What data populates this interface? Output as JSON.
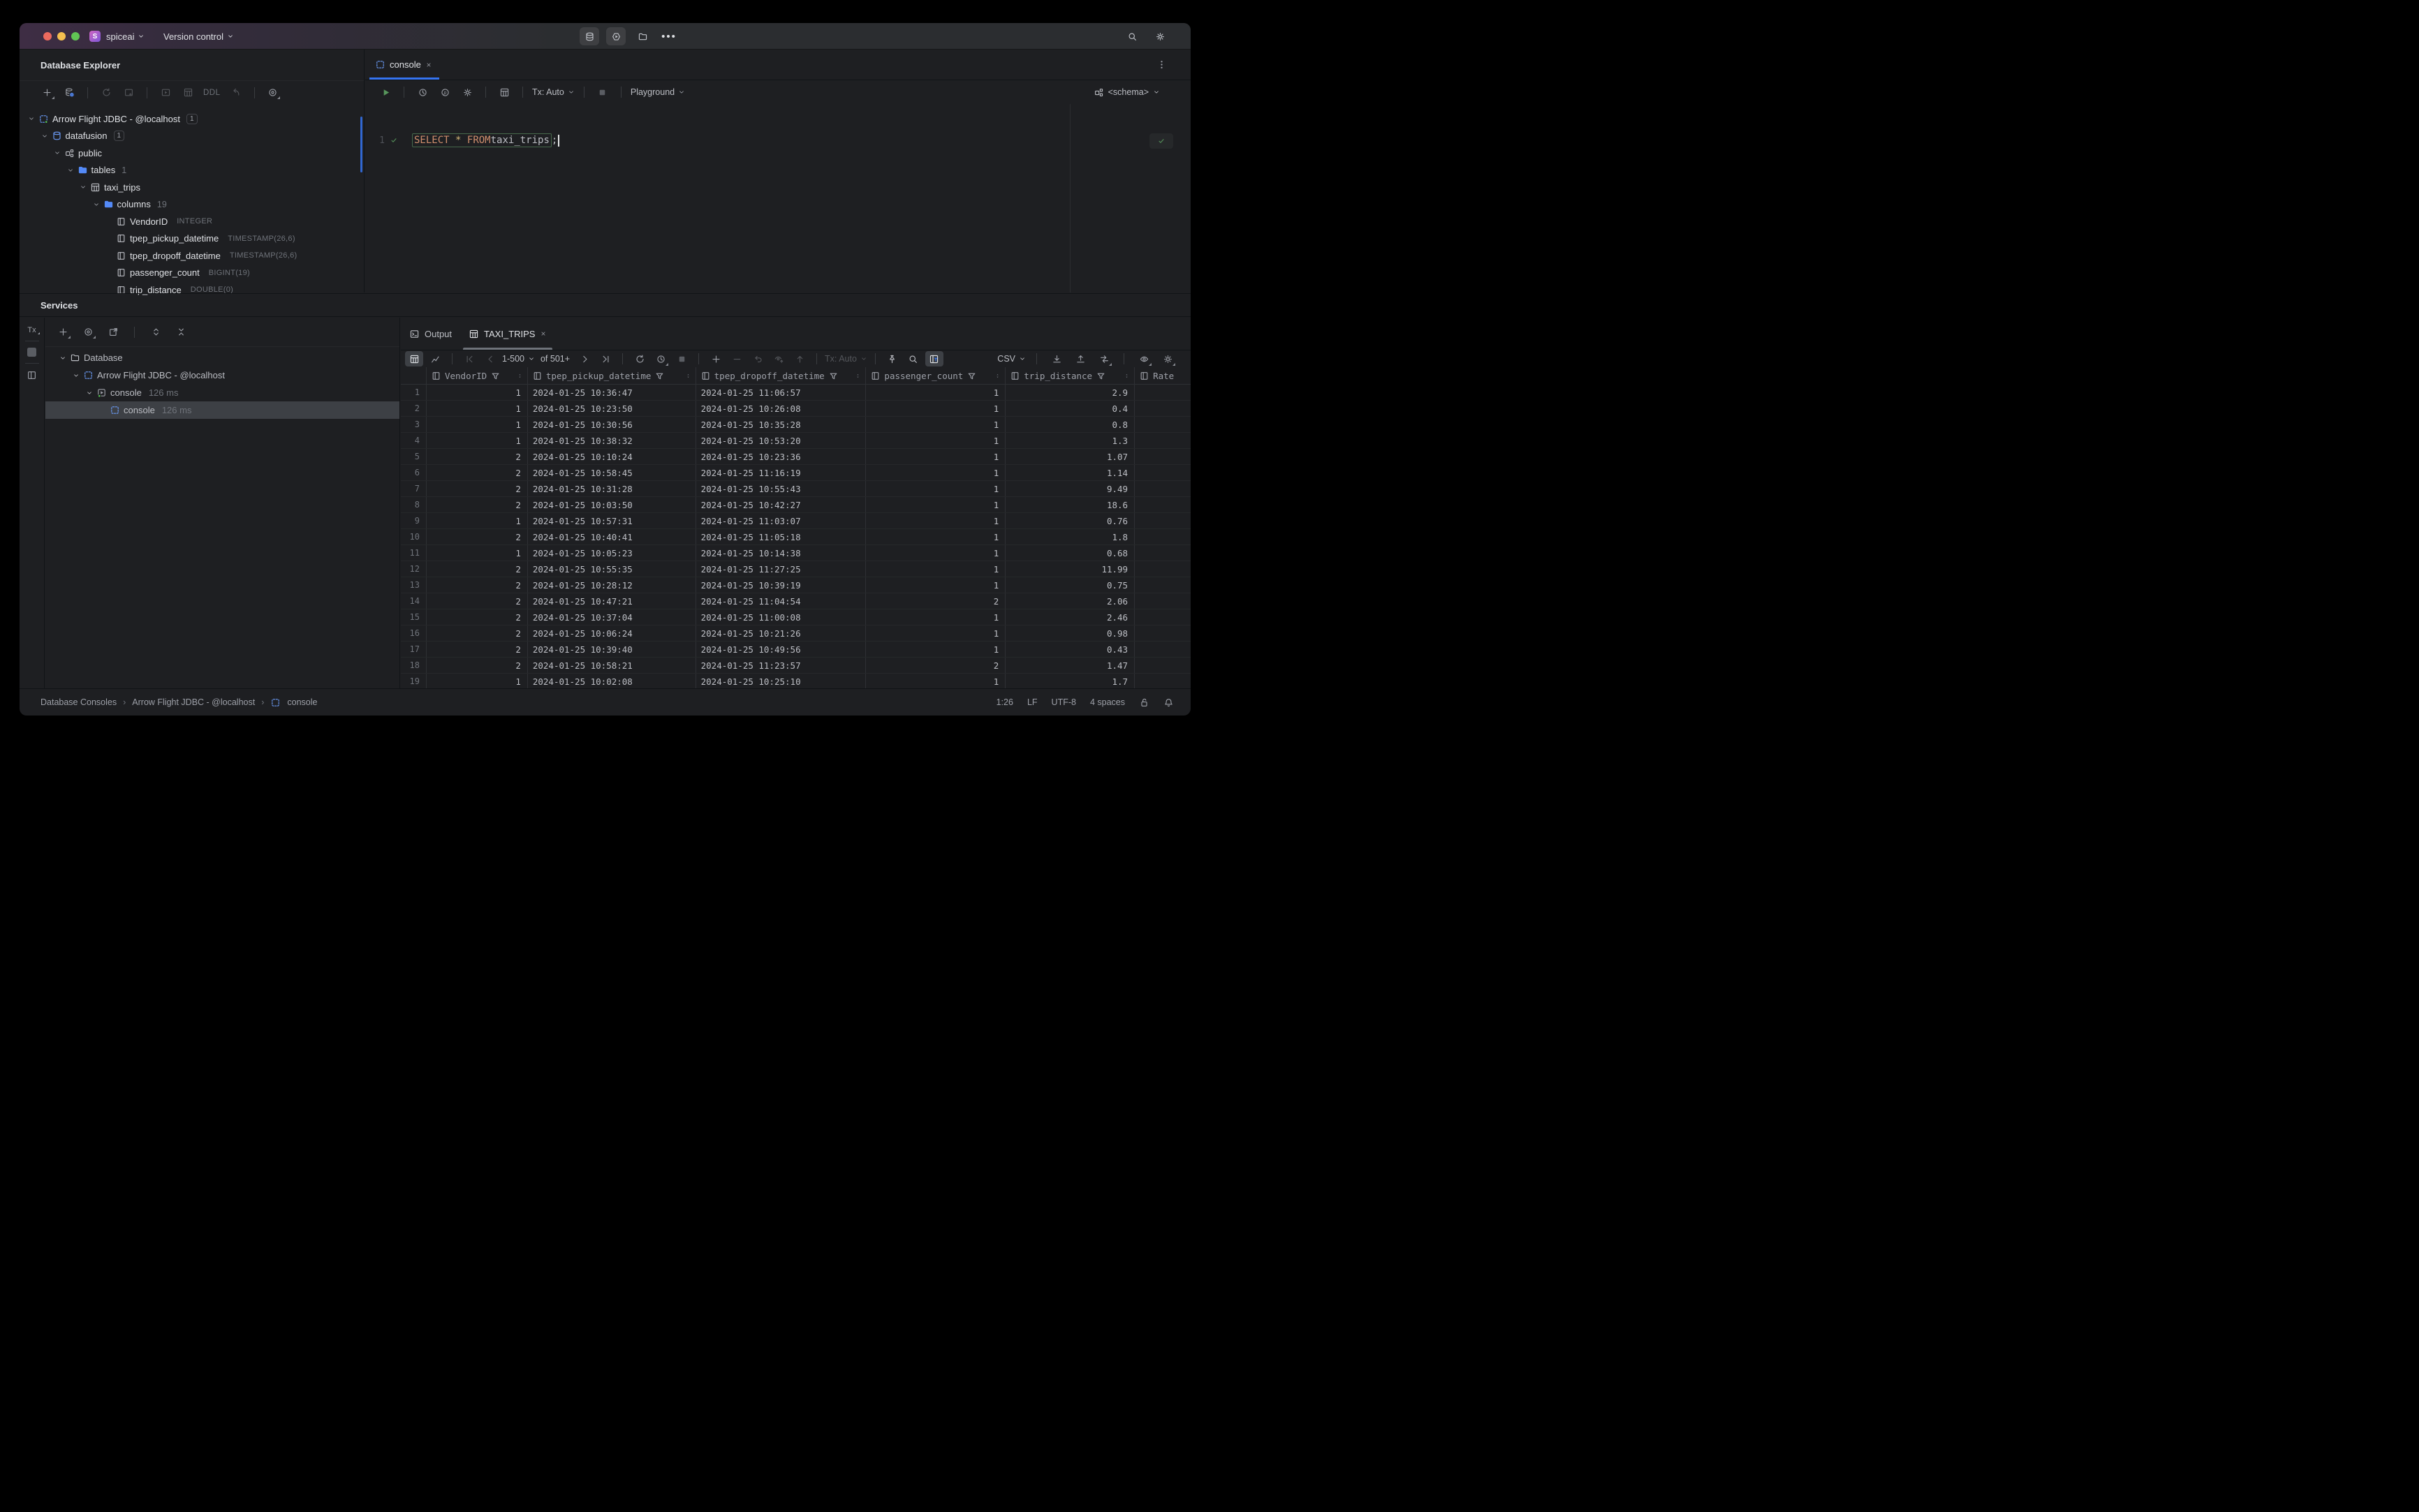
{
  "titlebar": {
    "logo": "S",
    "project": "spiceai",
    "menu": "Version control"
  },
  "explorer": {
    "title": "Database Explorer",
    "toolbar_ddl": "DDL",
    "tree": [
      {
        "label": "Arrow Flight JDBC - @localhost",
        "badge": "1",
        "icon": "driver-green",
        "indent": 0,
        "chevron": true
      },
      {
        "label": "datafusion",
        "badge": "1",
        "icon": "database-blue",
        "indent": 1,
        "chevron": true
      },
      {
        "label": "public",
        "icon": "schema",
        "indent": 2,
        "chevron": true
      },
      {
        "label": "tables",
        "count": "1",
        "icon": "folder-blue",
        "indent": 3,
        "chevron": true
      },
      {
        "label": "taxi_trips",
        "icon": "table",
        "indent": 4,
        "chevron": true
      },
      {
        "label": "columns",
        "count": "19",
        "icon": "folder-blue",
        "indent": 5,
        "chevron": true
      },
      {
        "label": "VendorID",
        "type": "INTEGER",
        "icon": "column",
        "indent": 6
      },
      {
        "label": "tpep_pickup_datetime",
        "type": "TIMESTAMP(26,6)",
        "icon": "column",
        "indent": 6
      },
      {
        "label": "tpep_dropoff_datetime",
        "type": "TIMESTAMP(26,6)",
        "icon": "column",
        "indent": 6
      },
      {
        "label": "passenger_count",
        "type": "BIGINT(19)",
        "icon": "column",
        "indent": 6
      },
      {
        "label": "trip_distance",
        "type": "DOUBLE(0)",
        "icon": "column",
        "indent": 6
      }
    ]
  },
  "editor": {
    "tab": "console",
    "line_number": "1",
    "sql": {
      "kw1": "SELECT",
      "star": "*",
      "kw2": "FROM",
      "ident": " taxi_trips",
      "semi": ";"
    },
    "tx": "Tx: Auto",
    "playground": "Playground",
    "schema": "<schema>"
  },
  "services": {
    "title": "Services",
    "strip_tx": "Tx",
    "tree": [
      {
        "label": "Database",
        "icon": "folder-plain",
        "indent": 0,
        "chevron": true
      },
      {
        "label": "Arrow Flight JDBC - @localhost",
        "icon": "driver",
        "indent": 1,
        "chevron": true
      },
      {
        "label": "console",
        "time": "126 ms",
        "icon": "run-green",
        "indent": 2,
        "chevron": true
      },
      {
        "label": "console",
        "time": "126 ms",
        "icon": "driver",
        "indent": 3,
        "selected": true
      }
    ]
  },
  "results": {
    "output_tab": "Output",
    "result_tab": "TAXI_TRIPS",
    "range": "1-500",
    "of": "of 501+",
    "tx": "Tx: Auto",
    "format": "CSV"
  },
  "grid": {
    "columns": [
      "VendorID",
      "tpep_pickup_datetime",
      "tpep_dropoff_datetime",
      "passenger_count",
      "trip_distance",
      "Rate"
    ],
    "rows": [
      [
        "1",
        "2024-01-25 10:36:47",
        "2024-01-25 11:06:57",
        "1",
        "2.9"
      ],
      [
        "1",
        "2024-01-25 10:23:50",
        "2024-01-25 10:26:08",
        "1",
        "0.4"
      ],
      [
        "1",
        "2024-01-25 10:30:56",
        "2024-01-25 10:35:28",
        "1",
        "0.8"
      ],
      [
        "1",
        "2024-01-25 10:38:32",
        "2024-01-25 10:53:20",
        "1",
        "1.3"
      ],
      [
        "2",
        "2024-01-25 10:10:24",
        "2024-01-25 10:23:36",
        "1",
        "1.07"
      ],
      [
        "2",
        "2024-01-25 10:58:45",
        "2024-01-25 11:16:19",
        "1",
        "1.14"
      ],
      [
        "2",
        "2024-01-25 10:31:28",
        "2024-01-25 10:55:43",
        "1",
        "9.49"
      ],
      [
        "2",
        "2024-01-25 10:03:50",
        "2024-01-25 10:42:27",
        "1",
        "18.6"
      ],
      [
        "1",
        "2024-01-25 10:57:31",
        "2024-01-25 11:03:07",
        "1",
        "0.76"
      ],
      [
        "2",
        "2024-01-25 10:40:41",
        "2024-01-25 11:05:18",
        "1",
        "1.8"
      ],
      [
        "1",
        "2024-01-25 10:05:23",
        "2024-01-25 10:14:38",
        "1",
        "0.68"
      ],
      [
        "2",
        "2024-01-25 10:55:35",
        "2024-01-25 11:27:25",
        "1",
        "11.99"
      ],
      [
        "2",
        "2024-01-25 10:28:12",
        "2024-01-25 10:39:19",
        "1",
        "0.75"
      ],
      [
        "2",
        "2024-01-25 10:47:21",
        "2024-01-25 11:04:54",
        "2",
        "2.06"
      ],
      [
        "2",
        "2024-01-25 10:37:04",
        "2024-01-25 11:00:08",
        "1",
        "2.46"
      ],
      [
        "2",
        "2024-01-25 10:06:24",
        "2024-01-25 10:21:26",
        "1",
        "0.98"
      ],
      [
        "2",
        "2024-01-25 10:39:40",
        "2024-01-25 10:49:56",
        "1",
        "0.43"
      ],
      [
        "2",
        "2024-01-25 10:58:21",
        "2024-01-25 11:23:57",
        "2",
        "1.47"
      ],
      [
        "1",
        "2024-01-25 10:02:08",
        "2024-01-25 10:25:10",
        "1",
        "1.7"
      ]
    ]
  },
  "statusbar": {
    "breadcrumbs": [
      "Database Consoles",
      "Arrow Flight JDBC - @localhost",
      "console"
    ],
    "caret": "1:26",
    "eol": "LF",
    "encoding": "UTF-8",
    "indent": "4 spaces"
  },
  "colors": {
    "accent": "#3574f0",
    "green": "#57c454",
    "folder_blue": "#548af7",
    "keyword_orange": "#cf8e6d"
  }
}
